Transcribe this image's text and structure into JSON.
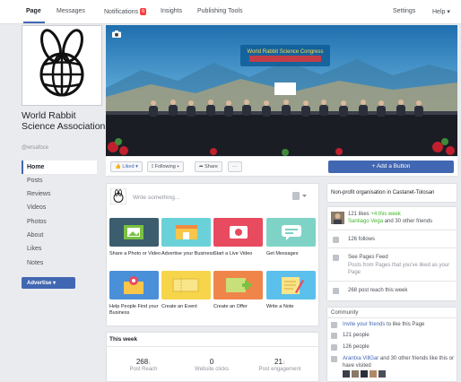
{
  "nav": {
    "tabs": [
      {
        "label": "Page"
      },
      {
        "label": "Messages"
      },
      {
        "label": "Notifications",
        "badge": "6"
      },
      {
        "label": "Insights"
      },
      {
        "label": "Publishing Tools"
      }
    ],
    "settings": "Settings",
    "help": "Help ▾"
  },
  "page": {
    "name": "World Rabbit Science Association",
    "handle": "@wrsafoce"
  },
  "sidebar": {
    "items": [
      {
        "label": "Home"
      },
      {
        "label": "Posts"
      },
      {
        "label": "Reviews"
      },
      {
        "label": "Videos"
      },
      {
        "label": "Photos"
      },
      {
        "label": "About"
      },
      {
        "label": "Likes"
      },
      {
        "label": "Notes"
      }
    ],
    "advertise": "Advertise ▾"
  },
  "actions": {
    "liked": "Liked ▾",
    "following": "Following ▾",
    "share": "Share",
    "more": "···",
    "add_button": "+ Add a Button"
  },
  "composer": {
    "placeholder": "Write something...",
    "tiles": [
      {
        "label": "Share a Photo or Video"
      },
      {
        "label": "Advertise your Business"
      },
      {
        "label": "Start a Live Video"
      },
      {
        "label": "Get Messages"
      },
      {
        "label": "Help People Find your Business"
      },
      {
        "label": "Create an Event"
      },
      {
        "label": "Create an Offer"
      },
      {
        "label": "Write a Note"
      }
    ]
  },
  "week": {
    "title": "This week",
    "stats": [
      {
        "value": "268",
        "label": "Post Reach"
      },
      {
        "value": "0",
        "label": "Website clicks"
      },
      {
        "value": "21",
        "label": "Post engagement"
      }
    ]
  },
  "right": {
    "category": "Non-profit organisation in Castanet-Tolosan",
    "likes_line1": "121 likes",
    "likes_delta": "+4 this week",
    "likes_line2a": "Santiago Vega",
    "likes_line2b": "and 30 other friends",
    "follows": "126 follows",
    "see_feed": "See Pages Feed",
    "feed_desc": "Posts from Pages that you've liked as your Page",
    "reach": "268 post reach this week",
    "community_title": "Community",
    "invite_a": "Invite your friends",
    "invite_b": "to like this Page",
    "people_like": "121 people",
    "people_follow": "126 people",
    "visited_a": "Arantxa VillGar",
    "visited_b": "and 30 other friends like this or have visited"
  },
  "cover": {
    "banner": "World Rabbit Science Congress"
  }
}
